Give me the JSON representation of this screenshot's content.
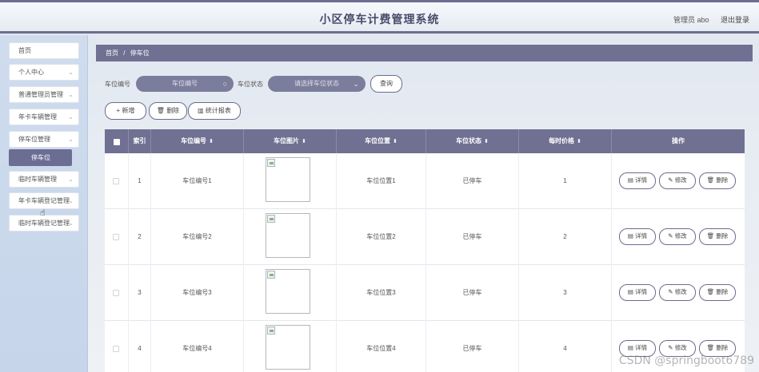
{
  "header": {
    "title": "小区停车计费管理系统",
    "user_label": "管理员 abo",
    "logout_label": "退出登录"
  },
  "sidebar": {
    "items": [
      {
        "label": "首页",
        "chevron": ""
      },
      {
        "label": "个人中心",
        "chevron": "⌄"
      },
      {
        "label": "普通管理员管理",
        "chevron": "⌄"
      },
      {
        "label": "年卡车辆管理",
        "chevron": "⌄"
      },
      {
        "label": "停车位管理",
        "chevron": "⌄"
      },
      {
        "label": "临时车辆管理",
        "chevron": "⌄"
      },
      {
        "label": "年卡车辆登记管理",
        "chevron": "⌄"
      },
      {
        "label": "临时车辆登记管理",
        "chevron": "⌄"
      }
    ],
    "active_sub": "停车位"
  },
  "breadcrumb": {
    "home": "首页",
    "sep": "/",
    "current": "停车位"
  },
  "search": {
    "lot_no_label": "车位编号",
    "lot_no_placeholder": "车位编号",
    "status_label": "车位状态",
    "status_placeholder": "请选择车位状态",
    "query_label": "查询"
  },
  "toolbar": {
    "add_label": "+ 新增",
    "delete_label": "删除",
    "report_label": "统计报表"
  },
  "table": {
    "headers": {
      "index": "索引",
      "lot_no": "车位编号",
      "image": "车位图片",
      "location": "车位位置",
      "status": "车位状态",
      "price": "每时价格",
      "ops": "操作"
    },
    "sort_mark": "⬍",
    "actions": {
      "detail": "详情",
      "edit": "修改",
      "delete": "删除"
    },
    "rows": [
      {
        "index": "1",
        "lot_no": "车位编号1",
        "location": "车位位置1",
        "status": "已停车",
        "price": "1"
      },
      {
        "index": "2",
        "lot_no": "车位编号2",
        "location": "车位位置2",
        "status": "已停车",
        "price": "2"
      },
      {
        "index": "3",
        "lot_no": "车位编号3",
        "location": "车位位置3",
        "status": "已停车",
        "price": "3"
      },
      {
        "index": "4",
        "lot_no": "车位编号4",
        "location": "车位位置4",
        "status": "已停车",
        "price": "4"
      }
    ]
  },
  "watermark": "CSDN @springboot6789"
}
